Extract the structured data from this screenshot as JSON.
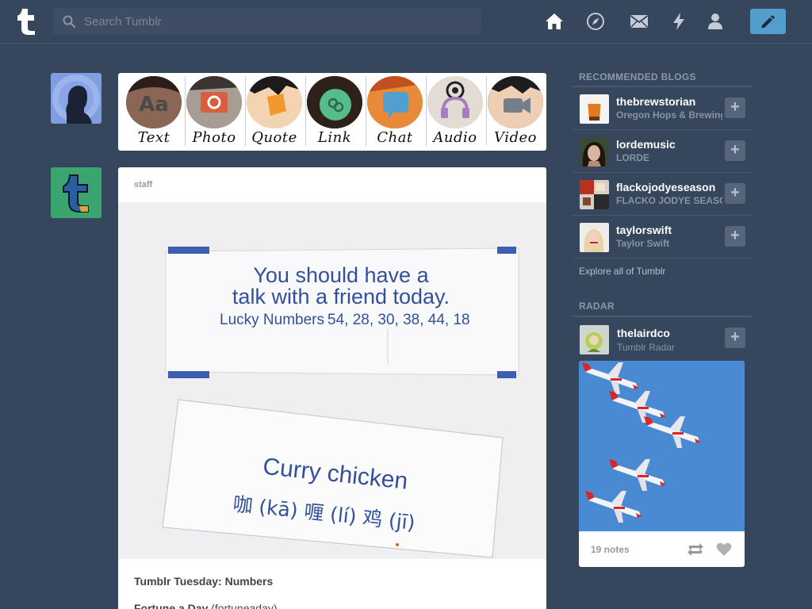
{
  "header": {
    "search_placeholder": "Search Tumblr",
    "nav": [
      "home-icon",
      "explore-icon",
      "inbox-icon",
      "activity-icon",
      "account-icon"
    ],
    "compose_icon": "pencil-icon"
  },
  "post_types": [
    {
      "label": "Text",
      "icon": "text-icon",
      "color": "#444444"
    },
    {
      "label": "Photo",
      "icon": "camera-icon",
      "color": "#d95e40"
    },
    {
      "label": "Quote",
      "icon": "quote-icon",
      "color": "#f2992e"
    },
    {
      "label": "Link",
      "icon": "link-icon",
      "color": "#56bc8a"
    },
    {
      "label": "Chat",
      "icon": "chat-icon",
      "color": "#529ecc"
    },
    {
      "label": "Audio",
      "icon": "headphones-icon",
      "color": "#a77dc2"
    },
    {
      "label": "Video",
      "icon": "video-camera-icon",
      "color": "#748089"
    }
  ],
  "post": {
    "author": "staff",
    "photo_text": {
      "fortune_line1": "You should have a",
      "fortune_line2": "talk with a friend today.",
      "lucky_label": "Lucky Numbers",
      "lucky_numbers": "54, 28, 30, 38, 44, 18",
      "lesson_title": "Curry chicken",
      "lesson_line": "咖 (kā) 喱 (lí) 鸡 (jī)"
    },
    "title": "Tumblr Tuesday: Numbers",
    "body_bold": "Fortune a Day",
    "body_rest": " (fortuneaday)"
  },
  "recommended": {
    "title": "RECOMMENDED BLOGS",
    "items": [
      {
        "name": "thebrewstorian",
        "subtitle": "Oregon Hops & Brewing"
      },
      {
        "name": "lordemusic",
        "subtitle": "LORDE"
      },
      {
        "name": "flackojodyeseason",
        "subtitle": "FLACKO JODYE SEASON"
      },
      {
        "name": "taylorswift",
        "subtitle": "Taylor Swift"
      }
    ],
    "follow_label": "+",
    "explore_label": "Explore all of Tumblr"
  },
  "radar": {
    "title": "RADAR",
    "blog": "thelairdco",
    "subtitle": "Tumblr Radar",
    "notes": "19 notes"
  },
  "colors": {
    "background": "#36465d",
    "compose_button": "#529ecc",
    "radar_sky": "#4a8ad2"
  }
}
